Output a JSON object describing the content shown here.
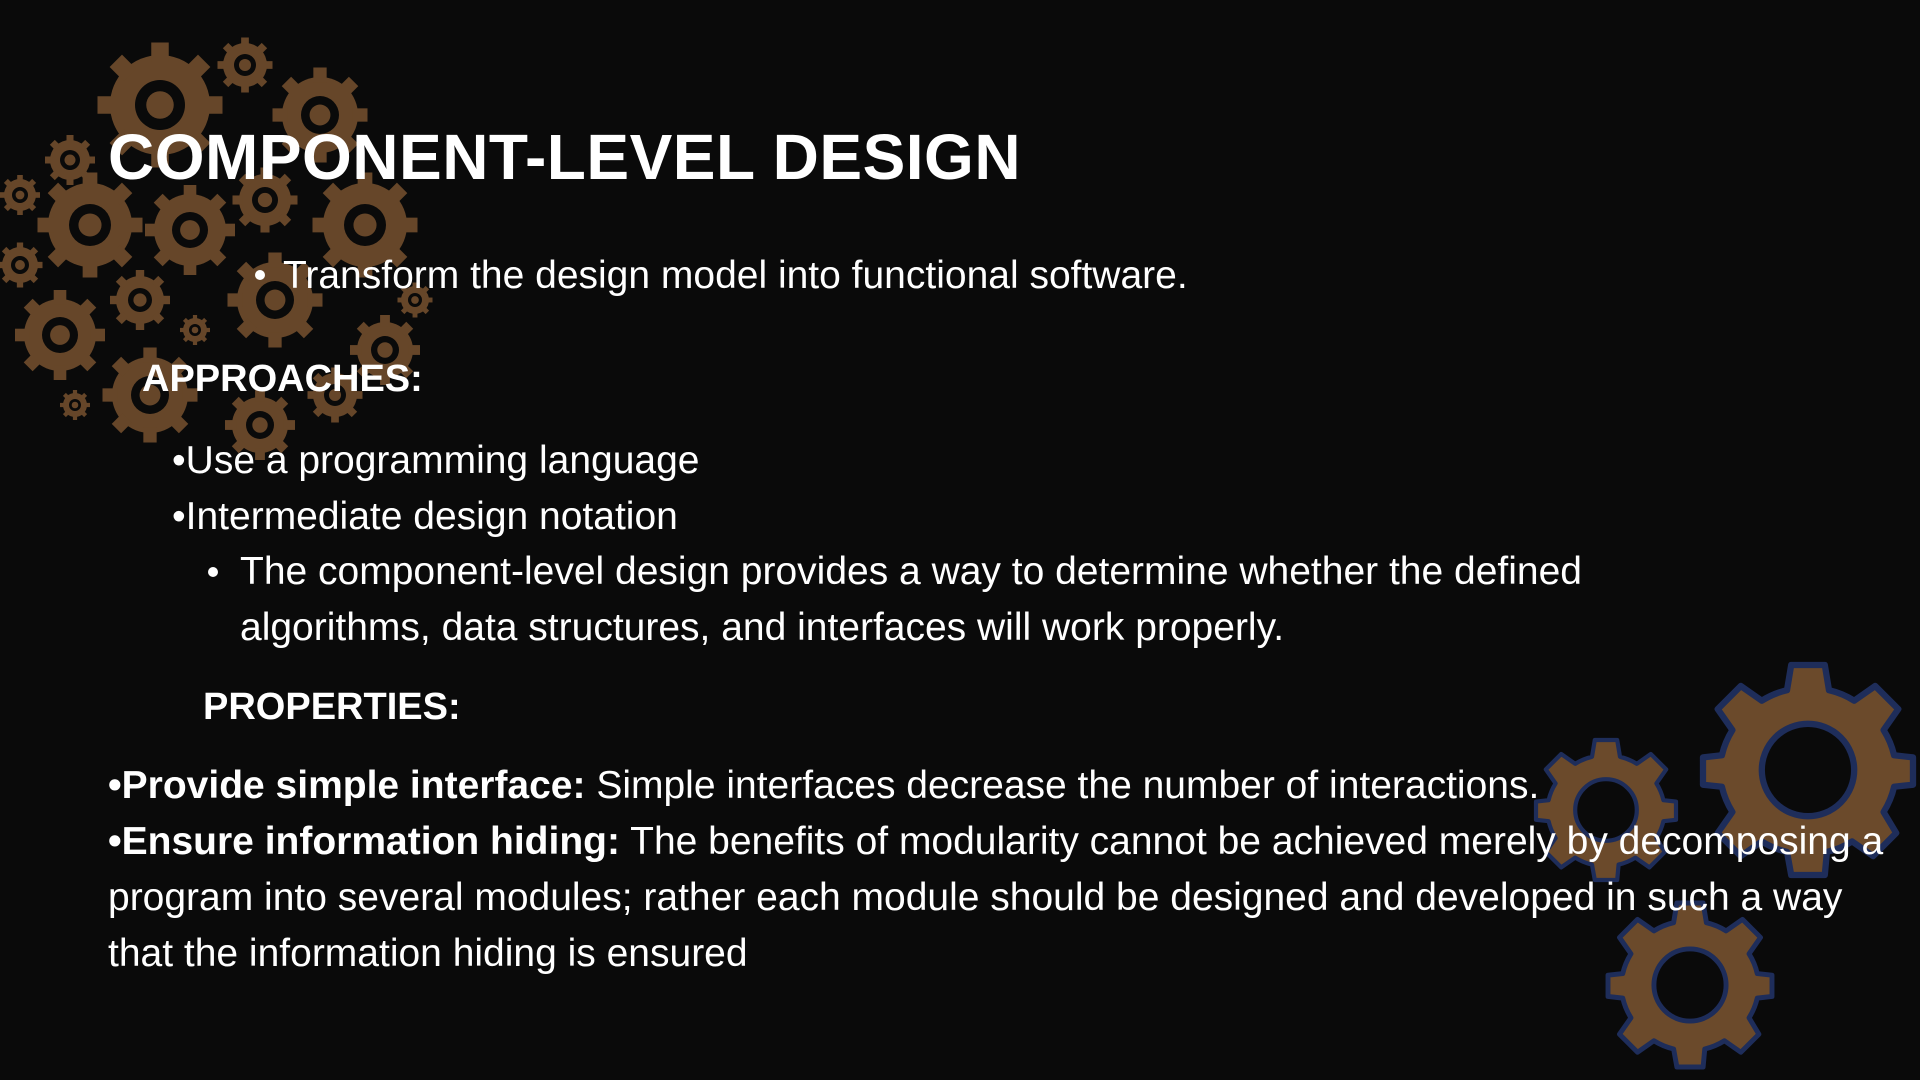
{
  "slide": {
    "title": "COMPONENT-LEVEL DESIGN",
    "intro_bullet": "Transform the design model into functional software.",
    "approaches_heading": "APPROACHES:",
    "approaches": [
      "•Use a programming language",
      "•Intermediate design notation"
    ],
    "note_bullet": "The component-level design provides a way to determine whether the defined algorithms, data structures, and interfaces will work properly.",
    "properties_heading": "PROPERTIES:",
    "properties": [
      {
        "label": "•Provide simple interface:",
        "text": " Simple interfaces decrease the number of interactions."
      },
      {
        "label": "•Ensure information hiding:",
        "text": " The benefits of modularity cannot be achieved merely by decomposing a program into several modules; rather each module should be designed and developed in such a way that the information hiding is ensured"
      }
    ]
  },
  "colors": {
    "background": "#0a0a0a",
    "text": "#ffffff",
    "gear_brown": "#6b4a2b",
    "gear_navy_outline": "#1e2d5a"
  },
  "decorations": {
    "top_left": "gears-cluster-icon",
    "bottom_right": "gears-outline-icon"
  }
}
